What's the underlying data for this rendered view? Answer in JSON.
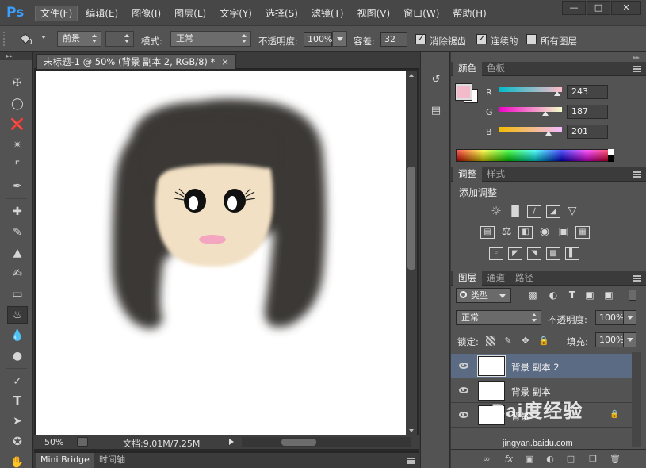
{
  "app": {
    "logo": "Ps"
  },
  "menu": [
    "文件(F)",
    "编辑(E)",
    "图像(I)",
    "图层(L)",
    "文字(Y)",
    "选择(S)",
    "滤镜(T)",
    "视图(V)",
    "窗口(W)",
    "帮助(H)"
  ],
  "window_controls": [
    "minimize-icon",
    "restore-icon",
    "close-icon"
  ],
  "options": {
    "tool_icon": "paint-bucket-icon",
    "fill_source": "前景",
    "mode_label": "模式:",
    "mode_value": "正常",
    "opacity_label": "不透明度:",
    "opacity_value": "100%",
    "tolerance_label": "容差:",
    "tolerance_value": "32",
    "anti_alias_label": "消除锯齿",
    "anti_alias_checked": true,
    "contiguous_label": "连续的",
    "contiguous_checked": true,
    "all_layers_label": "所有图层",
    "all_layers_checked": false
  },
  "document": {
    "tab_title": "未标题-1 @ 50% (背景 副本 2, RGB/8) *",
    "zoom": "50%",
    "doc_info": "文档:9.01M/7.25M"
  },
  "bottom_tabs": [
    "Mini Bridge",
    "时间轴"
  ],
  "color_panel": {
    "tabs": [
      "颜色",
      "色板"
    ],
    "foreground": "#f3bbc9",
    "background": "#ffffff",
    "channels": [
      {
        "label": "R",
        "value": "243"
      },
      {
        "label": "G",
        "value": "187"
      },
      {
        "label": "B",
        "value": "201"
      }
    ]
  },
  "adjust_panel": {
    "tabs": [
      "调整",
      "样式"
    ],
    "title": "添加调整"
  },
  "layers_panel": {
    "tabs": [
      "图层",
      "通道",
      "路径"
    ],
    "filter_label": "类型",
    "blend_mode": "正常",
    "opacity_label": "不透明度:",
    "opacity_value": "100%",
    "lock_label": "锁定:",
    "fill_label": "填充:",
    "fill_value": "100%",
    "layers": [
      {
        "name": "背景 副本 2",
        "selected": true
      },
      {
        "name": "背景 副本",
        "selected": false
      },
      {
        "name": "背景",
        "selected": false,
        "locked": true
      }
    ]
  },
  "watermark": {
    "main": "Bai度经验",
    "sub": "jingyan.baidu.com"
  }
}
